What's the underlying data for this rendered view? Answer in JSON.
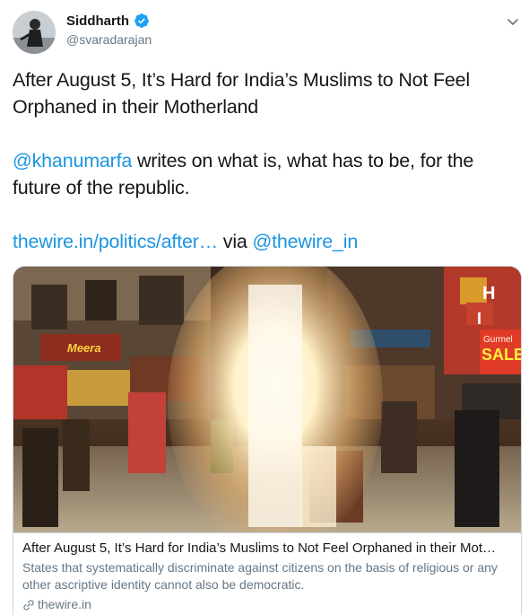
{
  "author": {
    "display_name": "Siddharth",
    "handle": "@svaradarajan",
    "verified": true,
    "avatar_icon": "avatar-photo"
  },
  "header": {
    "menu_icon": "chevron-down-icon"
  },
  "tweet": {
    "line1": "After August 5, It’s Hard for India’s Muslims to Not Feel Orphaned in their Motherland",
    "mention": "@khanumarfa",
    "line2_rest": " writes on what is, what has to be, for the future of the republic.",
    "url": "thewire.in/politics/after…",
    "via_text": " via ",
    "via_handle": "@thewire_in"
  },
  "card": {
    "title": "After August 5, It’s Hard for India’s Muslims to Not Feel Orphaned in their Mot…",
    "description": "States that systematically discriminate against citizens on the basis of religious or any other ascriptive identity cannot also be democratic.",
    "domain": "thewire.in",
    "domain_icon": "link-icon",
    "image_signs": [
      "Gurmel",
      "SALE",
      "H",
      "I",
      "Meera"
    ]
  },
  "colors": {
    "link": "#1b95e0",
    "secondary_text": "#657786",
    "border": "#ccd6dd",
    "verified": "#1da1f2"
  }
}
